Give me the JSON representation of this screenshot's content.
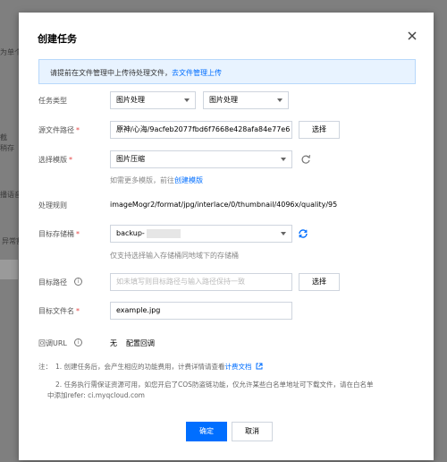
{
  "background": {
    "fragments": [
      "为单个文",
      "截",
      "稍存",
      "播语音",
      "异常割"
    ]
  },
  "dialog": {
    "title": "创建任务",
    "notice": {
      "text": "请提前在文件管理中上传待处理文件，",
      "link": "去文件管理上传"
    },
    "task_type": {
      "label": "任务类型",
      "primary": "图片处理",
      "secondary": "图片处理"
    },
    "source_path": {
      "label": "源文件路径",
      "value": "原神/心海/9acfeb2077fbd6f7668e428afa84e77e6",
      "button": "选择"
    },
    "template": {
      "label": "选择模版",
      "value": "图片压缩",
      "hint_text": "如需更多模版，前往",
      "hint_link": "创建模版"
    },
    "rule": {
      "label": "处理规则",
      "value": "imageMogr2/format/jpg/interlace/0/thumbnail/4096x/quality/95"
    },
    "target_bucket": {
      "label": "目标存储桶",
      "value": "backup-",
      "hint": "仅支持选择输入存储桶同地域下的存储桶"
    },
    "target_path": {
      "label": "目标路径",
      "placeholder": "如未填写则目标路径与输入路径保持一致",
      "button": "选择"
    },
    "target_filename": {
      "label": "目标文件名",
      "value": "example.jpg"
    },
    "callback": {
      "label": "回调URL",
      "value": "无",
      "link": "配置回调"
    },
    "notes": {
      "prefix": "注：",
      "line1_text": "1. 创建任务后，会产生相应的功能费用，计费详情请查看",
      "line1_link": "计费文档",
      "line2a": "2. 任务执行需保证资源可用，如您开启了COS防盗链功能，仅允许某些白名单地址可下载文件，请在白名单",
      "line2b": "中添加refer: ci.myqcloud.com"
    },
    "confirm": "确定",
    "cancel": "取消"
  },
  "colors": {
    "accent": "#006eff",
    "required": "#e54545",
    "notice_bg": "#e8f3ff"
  }
}
